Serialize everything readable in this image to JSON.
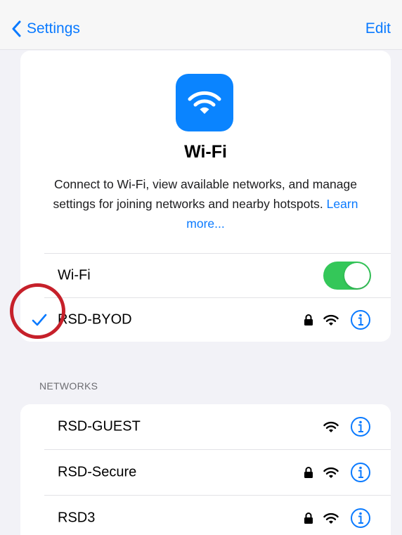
{
  "nav": {
    "back_label": "Settings",
    "edit_label": "Edit"
  },
  "header": {
    "title": "Wi-Fi",
    "description": "Connect to Wi-Fi, view available networks, and manage settings for joining networks and nearby hotspots.",
    "learn_more": "Learn more..."
  },
  "wifi_toggle": {
    "label": "Wi-Fi",
    "state": "on"
  },
  "connected_network": {
    "name": "RSD-BYOD",
    "secured": true,
    "connected": true
  },
  "networks_section": {
    "header": "NETWORKS",
    "items": [
      {
        "name": "RSD-GUEST",
        "secured": false
      },
      {
        "name": "RSD-Secure",
        "secured": true
      },
      {
        "name": "RSD3",
        "secured": true
      }
    ]
  },
  "colors": {
    "accent": "#0a7aff",
    "toggle_on": "#34c759",
    "annotation": "#c6202a",
    "icon_bg": "#0a84ff"
  },
  "icons": [
    "chevron-left-icon",
    "wifi-icon",
    "lock-icon",
    "info-icon",
    "checkmark-icon"
  ]
}
